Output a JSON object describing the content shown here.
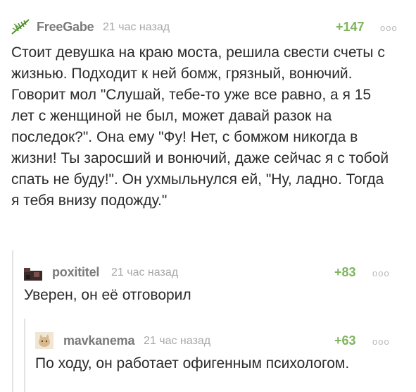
{
  "comments": [
    {
      "author": "FreeGabe",
      "time": "21 час назад",
      "rating": "+147",
      "more_icon": "ooo",
      "avatar_icon": "green-leaf-avatar",
      "text": "Стоит девушка на краю моста, решила свести счеты с жизнью. Подходит к ней бомж, грязный, вонючий. Говорит мол \"Слушай, тебе-то уже все равно, а я 15 лет с женщиной не был, может давай разок на последок?\". Она ему \"Фу! Нет, с бомжом никогда в жизни! Ты заросший и вонючий, даже сейчас я с тобой спать не буду!\". Он ухмыльнулся ей, \"Ну, ладно. Тогда я тебя внизу подожду.\""
    },
    {
      "author": "poxititel",
      "time": "21 час назад",
      "rating": "+83",
      "more_icon": "ooo",
      "avatar_icon": "dark-photo-avatar",
      "text": "Уверен, он её отговорил"
    },
    {
      "author": "mavkanema",
      "time": "21 час назад",
      "rating": "+63",
      "more_icon": "ooo",
      "avatar_icon": "cat-photo-avatar",
      "text": "По ходу, он работает офигенным психологом."
    }
  ],
  "colors": {
    "rating": "#7fb55e",
    "author": "#7a7a7a",
    "time": "#a8a8a8",
    "text": "#2b2b2b",
    "thread_line": "#e2e2e2"
  }
}
